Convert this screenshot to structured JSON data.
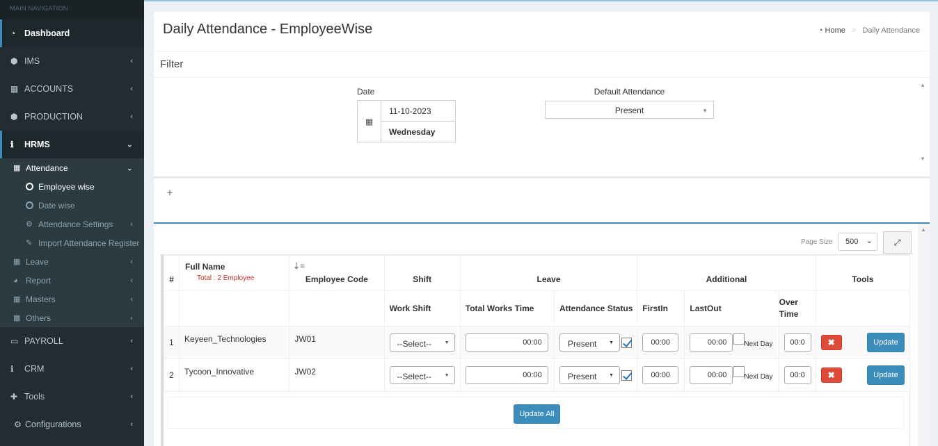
{
  "sidebar": {
    "header": "MAIN NAVIGATION",
    "items": [
      {
        "label": "Dashboard",
        "icon": "dashboard-icon"
      },
      {
        "label": "IMS",
        "icon": "cubes-icon"
      },
      {
        "label": "ACCOUNTS",
        "icon": "calculator-icon"
      },
      {
        "label": "PRODUCTION",
        "icon": "cubes-icon"
      },
      {
        "label": "HRMS",
        "icon": "info-icon"
      },
      {
        "label": "PAYROLL",
        "icon": "credit-card-icon"
      },
      {
        "label": "CRM",
        "icon": "info-icon"
      },
      {
        "label": "Tools",
        "icon": "puzzle-icon"
      },
      {
        "label": "Configurations",
        "icon": "cogs-icon"
      }
    ],
    "hrms_sub": {
      "attendance": "Attendance",
      "attendance_children": [
        "Employee wise",
        "Date wise",
        "Attendance Settings",
        "Import Attendance Register"
      ],
      "others": [
        "Leave",
        "Report",
        "Masters",
        "Others"
      ]
    }
  },
  "page": {
    "title": "Daily Attendance - EmployeeWise",
    "breadcrumb_home": "Home",
    "breadcrumb_current": "Daily Attendance"
  },
  "filter": {
    "heading": "Filter",
    "date_label": "Date",
    "date_value": "11-10-2023",
    "day_value": "Wednesday",
    "default_attendance_label": "Default Attendance",
    "default_attendance_value": "Present"
  },
  "grid": {
    "page_size_label": "Page Size",
    "page_size_value": "500",
    "headers": {
      "num": "#",
      "full_name": "Full Name",
      "total": "Total : 2 Employee",
      "employee_code": "Employee Code",
      "shift": "Shift",
      "leave": "Leave",
      "additional": "Additional",
      "tools": "Tools",
      "work_shift": "Work Shift",
      "total_works_time": "Total Works Time",
      "attendance_status": "Attendance Status",
      "first_in": "FirstIn",
      "last_out": "LastOut",
      "over_time": "Over Time"
    },
    "rows": [
      {
        "num": "1",
        "name": "Keyeen_Technologies",
        "code": "JW01",
        "shift": "--Select--",
        "total_time": "00:00",
        "status": "Present",
        "first_in": "00:00",
        "last_out": "00:00",
        "next_day": "Next Day",
        "over_time": "00:0",
        "update": "Update"
      },
      {
        "num": "2",
        "name": "Tycoon_Innovative",
        "code": "JW02",
        "shift": "--Select--",
        "total_time": "00:00",
        "status": "Present",
        "first_in": "00:00",
        "last_out": "00:00",
        "next_day": "Next Day",
        "over_time": "00:0",
        "update": "Update"
      }
    ],
    "update_all": "Update All"
  }
}
